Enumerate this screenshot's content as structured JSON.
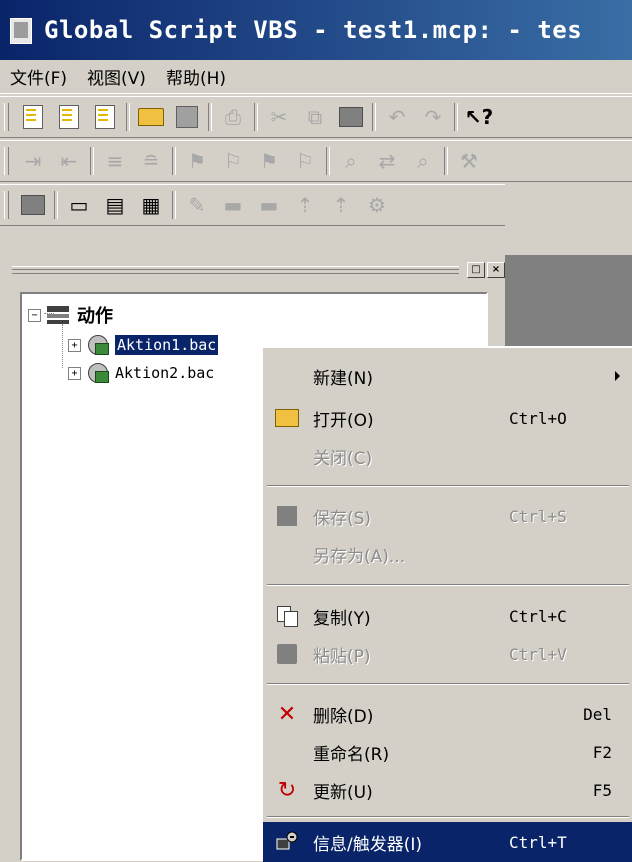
{
  "window": {
    "title": "Global Script VBS - test1.mcp: - tes"
  },
  "menubar": {
    "items": [
      "文件(F)",
      "视图(V)",
      "帮助(H)"
    ]
  },
  "tree": {
    "root_label": "动作",
    "items": [
      {
        "label": "Aktion1.bac",
        "selected": true
      },
      {
        "label": "Aktion2.bac",
        "selected": false
      }
    ],
    "root_toggle": "−",
    "item_toggle": "+"
  },
  "panel": {
    "restore_label": "□",
    "close_label": "×"
  },
  "context_menu": {
    "items": [
      {
        "label": "新建(N)",
        "shortcut": "",
        "submenu": true,
        "enabled": true,
        "icon": "none"
      },
      {
        "label": "打开(O)",
        "shortcut": "Ctrl+O",
        "enabled": true,
        "icon": "open-folder-icon"
      },
      {
        "label": "关闭(C)",
        "shortcut": "",
        "enabled": false,
        "icon": "none"
      },
      {
        "label": "保存(S)",
        "shortcut": "Ctrl+S",
        "enabled": false,
        "icon": "save-icon"
      },
      {
        "label": "另存为(A)...",
        "shortcut": "",
        "enabled": false,
        "icon": "none"
      },
      {
        "label": "复制(Y)",
        "shortcut": "Ctrl+C",
        "enabled": true,
        "icon": "copy-icon"
      },
      {
        "label": "粘贴(P)",
        "shortcut": "Ctrl+V",
        "enabled": false,
        "icon": "paste-icon"
      },
      {
        "label": "删除(D)",
        "shortcut": "Del",
        "enabled": true,
        "icon": "delete-x-icon"
      },
      {
        "label": "重命名(R)",
        "shortcut": "F2",
        "enabled": true,
        "icon": "none"
      },
      {
        "label": "更新(U)",
        "shortcut": "F5",
        "enabled": true,
        "icon": "refresh-icon"
      },
      {
        "label": "信息/触发器(I)",
        "shortcut": "Ctrl+T",
        "enabled": true,
        "highlighted": true,
        "icon": "info-trigger-icon"
      }
    ]
  },
  "colors": {
    "highlight": "#0a246a",
    "face": "#d4d0c8",
    "workspace": "#808080",
    "delete_red": "#c00000"
  }
}
